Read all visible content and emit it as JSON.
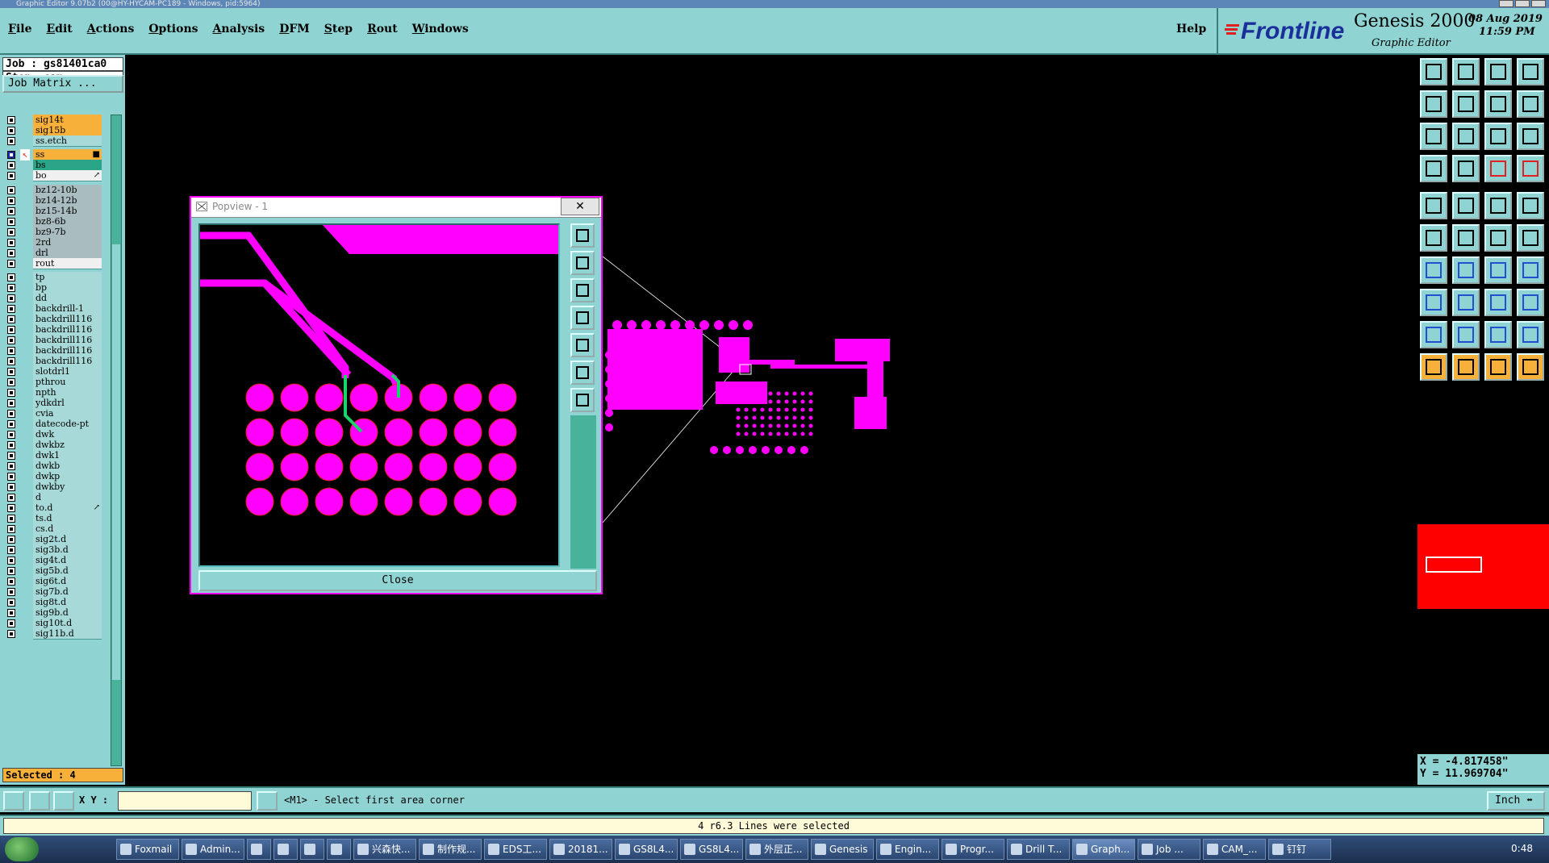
{
  "window": {
    "title": "Graphic Editor 9.07b2 (00@HY-HYCAM-PC189 - Windows, pid:5964)"
  },
  "menu": {
    "items": [
      "File",
      "Edit",
      "Actions",
      "Options",
      "Analysis",
      "DFM",
      "Step",
      "Rout",
      "Windows"
    ],
    "help": "Help"
  },
  "brand": {
    "logo": "Frontline",
    "product": "Genesis 2000",
    "subtitle": "Graphic Editor",
    "date": "08 Aug 2019",
    "time": "11:59 PM"
  },
  "job": {
    "job_line": "Job : gs81401ca0",
    "step_line": "Step: cam",
    "matrix_button": "Job Matrix ..."
  },
  "layers": [
    {
      "name": "sig14t",
      "style": "orange"
    },
    {
      "name": "sig15b",
      "style": "orange"
    },
    {
      "name": "ss.etch",
      "style": "teal"
    },
    {
      "name": "ss",
      "style": "orange",
      "active": true,
      "mark": "■"
    },
    {
      "name": "bs",
      "style": "green"
    },
    {
      "name": "bo",
      "style": "white",
      "mark": "↗"
    },
    {
      "name": "bz12-10b",
      "style": "grey"
    },
    {
      "name": "bz14-12b",
      "style": "grey"
    },
    {
      "name": "bz15-14b",
      "style": "grey"
    },
    {
      "name": "bz8-6b",
      "style": "grey"
    },
    {
      "name": "bz9-7b",
      "style": "grey"
    },
    {
      "name": "2rd",
      "style": "grey"
    },
    {
      "name": "drl",
      "style": "grey"
    },
    {
      "name": "rout",
      "style": "white"
    },
    {
      "name": "tp",
      "style": "teal"
    },
    {
      "name": "bp",
      "style": "teal"
    },
    {
      "name": "dd",
      "style": "teal"
    },
    {
      "name": "backdrill-1",
      "style": "teal"
    },
    {
      "name": "backdrill116",
      "style": "teal"
    },
    {
      "name": "backdrill116",
      "style": "teal"
    },
    {
      "name": "backdrill116",
      "style": "teal"
    },
    {
      "name": "backdrill116",
      "style": "teal"
    },
    {
      "name": "backdrill116",
      "style": "teal"
    },
    {
      "name": "slotdrl1",
      "style": "teal"
    },
    {
      "name": "pthrou",
      "style": "teal"
    },
    {
      "name": "npth",
      "style": "teal"
    },
    {
      "name": "ydkdrl",
      "style": "teal"
    },
    {
      "name": "cvia",
      "style": "teal"
    },
    {
      "name": "datecode-pt",
      "style": "teal"
    },
    {
      "name": "dwk",
      "style": "teal"
    },
    {
      "name": "dwkbz",
      "style": "teal"
    },
    {
      "name": "dwk1",
      "style": "teal"
    },
    {
      "name": "dwkb",
      "style": "teal"
    },
    {
      "name": "dwkp",
      "style": "teal"
    },
    {
      "name": "dwkby",
      "style": "teal"
    },
    {
      "name": "d",
      "style": "teal"
    },
    {
      "name": "to.d",
      "style": "teal",
      "mark": "↗"
    },
    {
      "name": "ts.d",
      "style": "teal"
    },
    {
      "name": "cs.d",
      "style": "teal"
    },
    {
      "name": "sig2t.d",
      "style": "teal"
    },
    {
      "name": "sig3b.d",
      "style": "teal"
    },
    {
      "name": "sig4t.d",
      "style": "teal"
    },
    {
      "name": "sig5b.d",
      "style": "teal"
    },
    {
      "name": "sig6t.d",
      "style": "teal"
    },
    {
      "name": "sig7b.d",
      "style": "teal"
    },
    {
      "name": "sig8t.d",
      "style": "teal"
    },
    {
      "name": "sig9b.d",
      "style": "teal"
    },
    {
      "name": "sig10t.d",
      "style": "teal"
    },
    {
      "name": "sig11b.d",
      "style": "teal"
    }
  ],
  "selected": "Selected : 4",
  "popview": {
    "title": "Popview - 1",
    "close": "Close",
    "x": "✕"
  },
  "coords": {
    "x": "X = -4.817458\"",
    "y": "Y = 11.969704\""
  },
  "status": {
    "xy_label": "X Y :",
    "prompt": "<M1> - Select first area corner",
    "unit": "Inch ⬌"
  },
  "message": "4 r6.3 Lines were selected",
  "taskbar": {
    "items": [
      "Foxmail",
      "Admin...",
      "",
      "",
      "",
      "",
      "兴森快...",
      "制作规...",
      "EDS工...",
      "20181...",
      "GS8L4...",
      "GS8L4...",
      "外层正...",
      "Genesis",
      "Engin...",
      "Progr...",
      "Drill T...",
      "Graph...",
      "Job ...",
      "CAM_...",
      "钉钉"
    ],
    "clock": "0:48"
  },
  "colors": {
    "panel": "#8fd4d2",
    "accent": "#f7b13a",
    "magenta": "#ff00ff",
    "trace_green": "#19d36b",
    "map_red": "#ff0000"
  }
}
